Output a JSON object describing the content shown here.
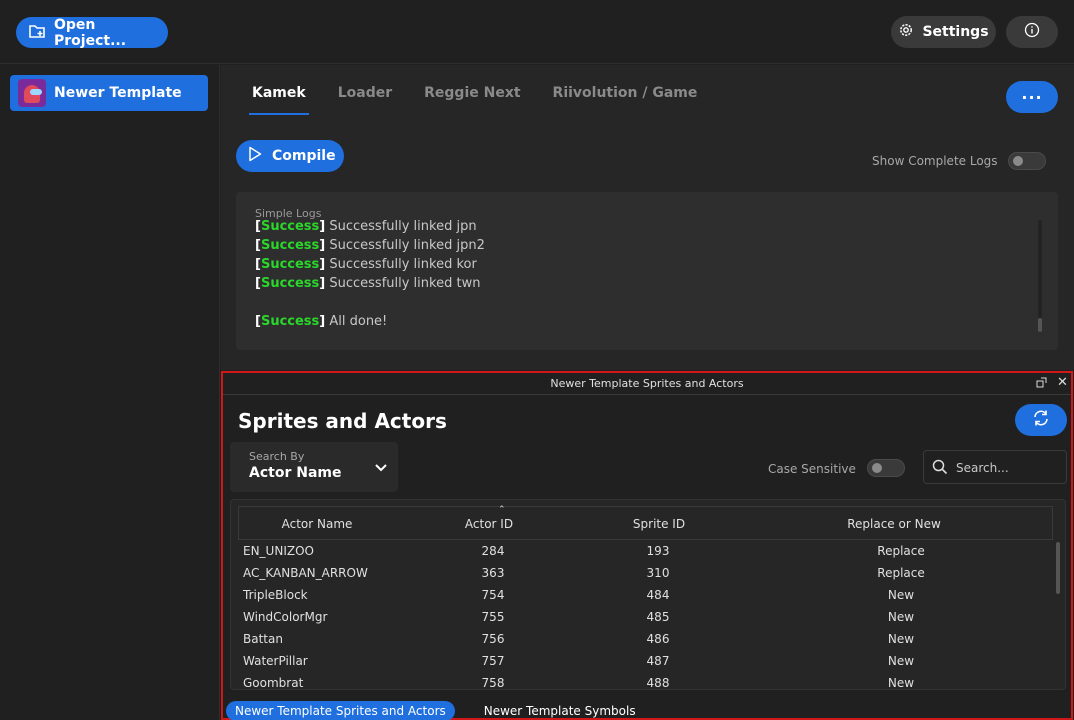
{
  "topbar": {
    "open_project_label": "Open Project...",
    "settings_label": "Settings"
  },
  "sidebar": {
    "items": [
      {
        "label": "Newer Template",
        "icon": "among-us-avatar"
      }
    ]
  },
  "main": {
    "tabs": [
      {
        "label": "Kamek",
        "active": true
      },
      {
        "label": "Loader",
        "active": false
      },
      {
        "label": "Reggie Next",
        "active": false
      },
      {
        "label": "Riivolution / Game",
        "active": false
      }
    ],
    "more_label": "···",
    "compile_label": "Compile",
    "show_logs_label": "Show Complete Logs",
    "show_logs_on": false,
    "logs": {
      "title": "Simple Logs",
      "lines": [
        {
          "tag": "Success",
          "text": " Successfully linked jpn"
        },
        {
          "tag": "Success",
          "text": " Successfully linked jpn2"
        },
        {
          "tag": "Success",
          "text": " Successfully linked kor"
        },
        {
          "tag": "Success",
          "text": " Successfully linked twn"
        },
        {
          "tag": "",
          "text": ""
        },
        {
          "tag": "Success",
          "text": " All done!"
        }
      ]
    }
  },
  "panel": {
    "title": "Newer Template Sprites and Actors",
    "heading": "Sprites and Actors",
    "search_by_label": "Search By",
    "search_by_value": "Actor Name",
    "case_sensitive_label": "Case Sensitive",
    "case_sensitive_on": false,
    "search_placeholder": "Search...",
    "table": {
      "columns": [
        "Actor Name",
        "Actor ID",
        "Sprite ID",
        "Replace or New"
      ],
      "rows": [
        [
          "EN_UNIZOO",
          "284",
          "193",
          "Replace"
        ],
        [
          "AC_KANBAN_ARROW",
          "363",
          "310",
          "Replace"
        ],
        [
          "TripleBlock",
          "754",
          "484",
          "New"
        ],
        [
          "WindColorMgr",
          "755",
          "485",
          "New"
        ],
        [
          "Battan",
          "756",
          "486",
          "New"
        ],
        [
          "WaterPillar",
          "757",
          "487",
          "New"
        ],
        [
          "Goombrat",
          "758",
          "488",
          "New"
        ]
      ]
    },
    "bottom_tabs": [
      {
        "label": "Newer Template Sprites and Actors",
        "active": true
      },
      {
        "label": "Newer Template Symbols",
        "active": false
      }
    ]
  },
  "colors": {
    "accent": "#1f6fde",
    "success": "#2bd62b",
    "highlight_border": "#d01818"
  }
}
